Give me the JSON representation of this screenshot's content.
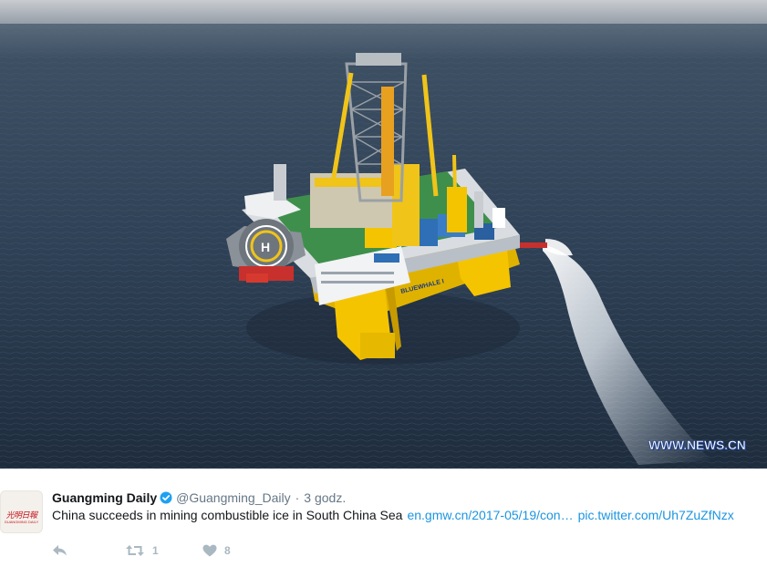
{
  "media": {
    "image_name": "offshore-drilling-rig-photo",
    "watermark": "WWW.NEWS.CN",
    "rig_hull_text": "BLUEWHALE I"
  },
  "tweet": {
    "author_name": "Guangming Daily",
    "handle": "@Guangming_Daily",
    "separator": "·",
    "timestamp": "3 godz.",
    "avatar_logo_text": "光明日報",
    "avatar_logo_subtext": "GUANGMING DAILY",
    "text": "China succeeds in mining combustible ice in South China Sea",
    "link": "en.gmw.cn/2017-05/19/con…",
    "pic_link": "pic.twitter.com/Uh7ZuZfNzx"
  },
  "actions": {
    "reply_icon": "reply-icon",
    "retweet_icon": "retweet-icon",
    "like_icon": "heart-icon",
    "retweet_count": "1",
    "like_count": "8"
  },
  "colors": {
    "link": "#1b95e0",
    "verified": "#1da1f2",
    "muted": "#657786",
    "action_icons": "#aab8c2",
    "rig_yellow": "#f5c400",
    "sea": "#2c3d52"
  }
}
